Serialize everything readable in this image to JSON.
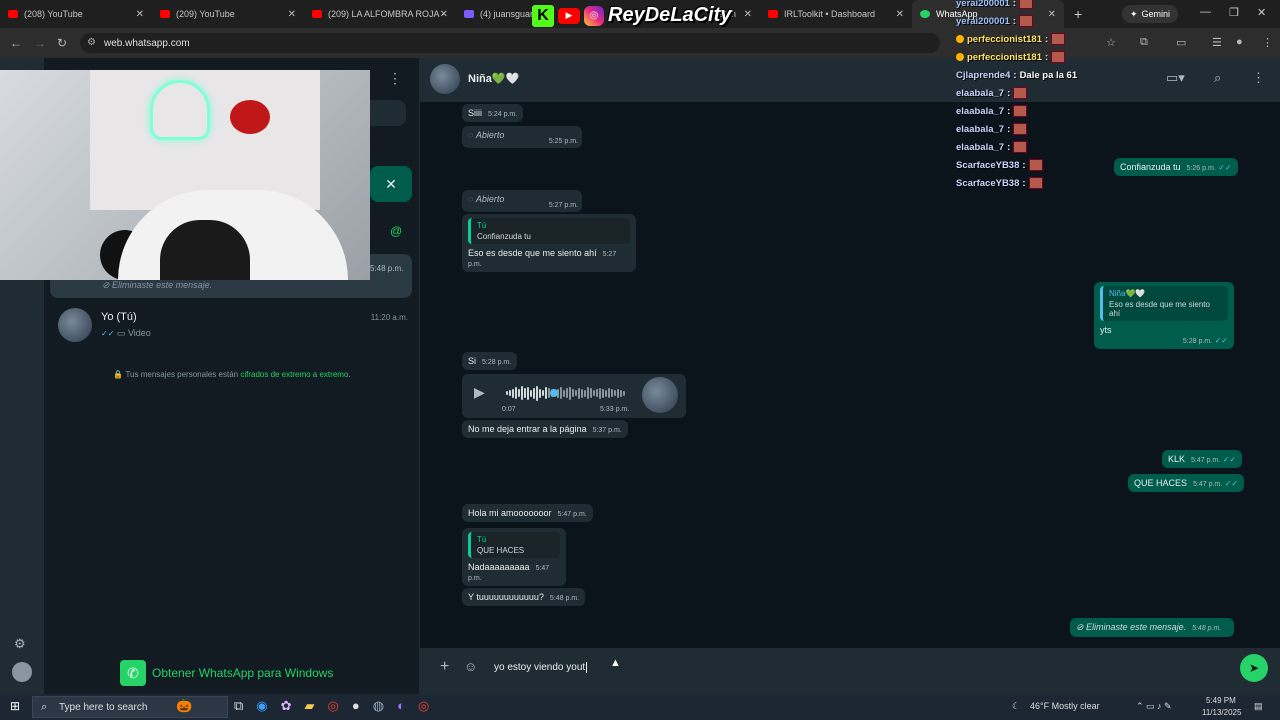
{
  "browser": {
    "tabs": [
      {
        "label": "(208) YouTube",
        "icon": "youtube-icon"
      },
      {
        "label": "(209) YouTube",
        "icon": "youtube-icon"
      },
      {
        "label": "(209) LA ALFOMBRA ROJA -",
        "icon": "youtube-icon"
      },
      {
        "label": "(4) juansguarn",
        "icon": "twitch-icon"
      },
      {
        "label": "atch",
        "icon": "kick-icon"
      },
      {
        "label": "IRLToolkit • Dashboard",
        "icon": "youtube-icon"
      },
      {
        "label": "WhatsApp",
        "icon": "whatsapp-icon"
      }
    ],
    "new_tab": "+",
    "gemini_label": "Gemini",
    "url": "web.whatsapp.com"
  },
  "stream_overlay": {
    "k_logo": "K",
    "channel_name": "ReyDeLaCity"
  },
  "stream_chat": [
    {
      "user": "yerai200001",
      "colon": ":",
      "text": ""
    },
    {
      "user": "yerai200001",
      "colon": ":",
      "text": ""
    },
    {
      "user": "perfeccionist181",
      "colon": ":",
      "text": ""
    },
    {
      "user": "perfeccionist181",
      "colon": ":",
      "text": ""
    },
    {
      "user": "Cjlaprende4",
      "colon": ":",
      "text": "Dale pa la 61"
    },
    {
      "user": "elaabala_7",
      "colon": ":",
      "text": ""
    },
    {
      "user": "elaabala_7",
      "colon": ":",
      "text": ""
    },
    {
      "user": "elaabala_7",
      "colon": ":",
      "text": ""
    },
    {
      "user": "elaabala_7",
      "colon": ":",
      "text": ""
    },
    {
      "user": "ScarfaceYB38",
      "colon": ":",
      "text": ""
    },
    {
      "user": "ScarfaceYB38",
      "colon": ":",
      "text": ""
    }
  ],
  "sidebar": {
    "partial_time": "5:48 p.m.",
    "deleted_preview": "Eliminaste este mensaje.",
    "self_chat": {
      "name": "Yo (Tú)",
      "time": "11:20 a.m.",
      "preview": "Video"
    },
    "encryption_text": "Tus mensajes personales están",
    "encryption_link": "cifrados de extremo a extremo",
    "encryption_end": ".",
    "get_app": "Obtener WhatsApp para Windows",
    "at_symbol": "@"
  },
  "chat": {
    "contact_name": "Niña💚🤍",
    "messages": {
      "m1": {
        "text": "Siiii",
        "time": "5:24 p.m."
      },
      "m2": {
        "text": "Abierto",
        "time": "5:25 p.m."
      },
      "m3": {
        "text": "Abierto",
        "time": "5:27 p.m."
      },
      "m4": {
        "quote_who": "Tú",
        "quote_text": "Confianzuda tu",
        "text": "Eso es desde que me siento ahí",
        "time": "5:27 p.m."
      },
      "o1": {
        "text": "Confianzuda tu",
        "time": "5:26 p.m."
      },
      "o2": {
        "quote_who": "Niña💚🤍",
        "quote_text": "Eso es desde que me siento ahí",
        "text": "yts",
        "time": "5:28 p.m."
      },
      "m5": {
        "text": "Si",
        "time": "5:28 p.m."
      },
      "voice": {
        "duration": "0:07",
        "time": "5:33 p.m."
      },
      "m6": {
        "text": "No me deja entrar a la página",
        "time": "5:37 p.m."
      },
      "o3": {
        "text": "KLK",
        "time": "5:47 p.m."
      },
      "o4": {
        "text": "QUE HACES",
        "time": "5:47 p.m."
      },
      "m7": {
        "text": "Hola mi amooooooor",
        "time": "5:47 p.m."
      },
      "m8": {
        "quote_who": "Tú",
        "quote_text": "QUE HACES",
        "text": "Nadaaaaaaaaa",
        "time": "5:47 p.m."
      },
      "m9": {
        "text": "Y tuuuuuuuuuuuu?",
        "time": "5:48 p.m."
      },
      "o5": {
        "text": "Eliminaste este mensaje.",
        "time": "5:48 p.m."
      }
    },
    "composer_value": "yo estoy viendo yout"
  },
  "taskbar": {
    "search_placeholder": "Type here to search",
    "weather": "46°F  Mostly clear",
    "time": "5:49 PM",
    "date": "11/13/2025"
  }
}
